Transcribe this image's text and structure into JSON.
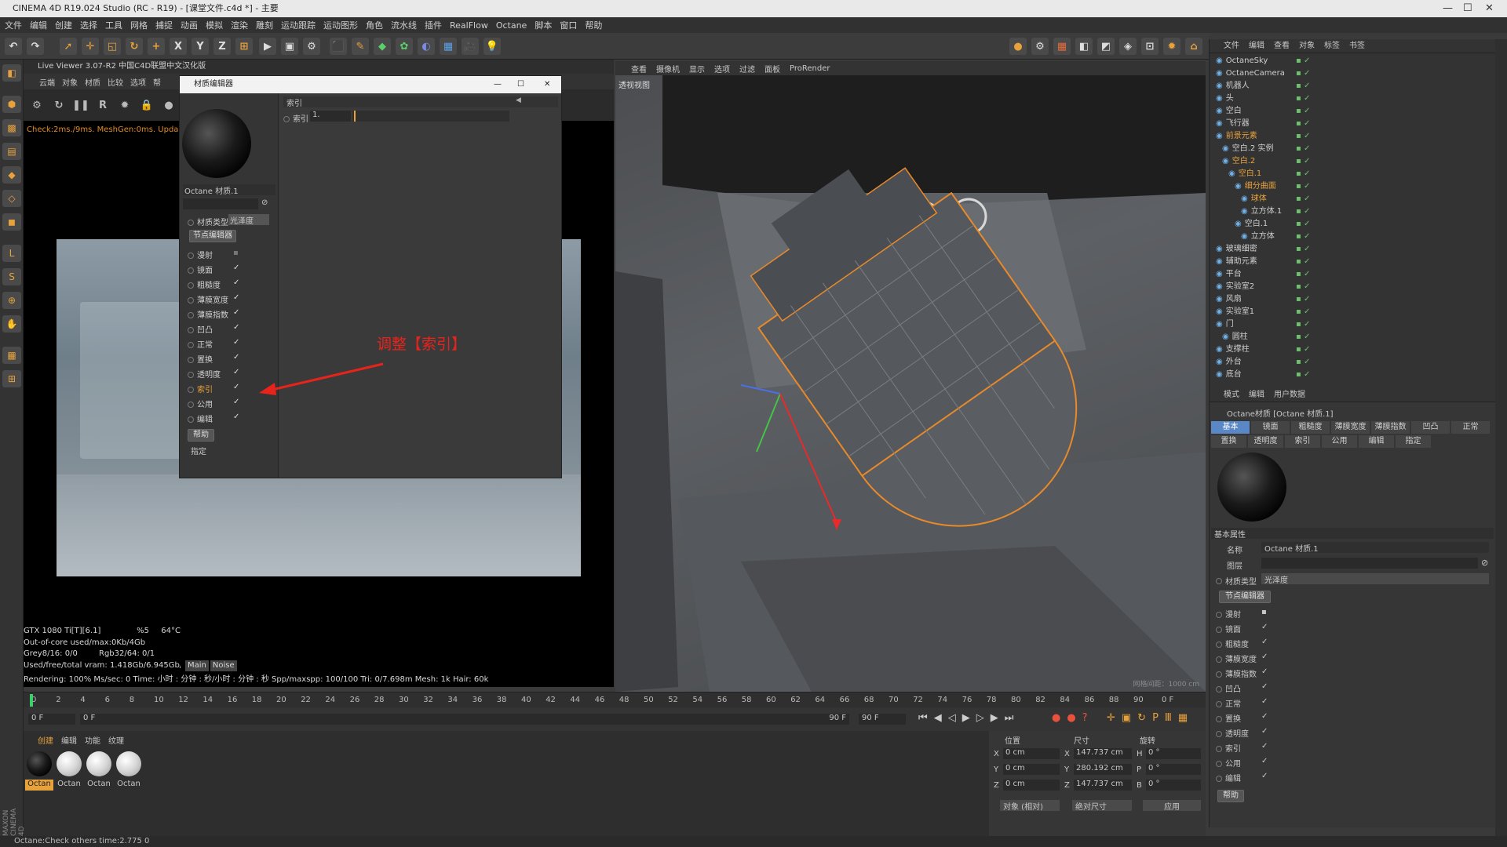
{
  "window": {
    "title": "CINEMA 4D R19.024 Studio (RC - R19) - [课堂文件.c4d *] - 主要"
  },
  "menu": [
    "文件",
    "编辑",
    "创建",
    "选择",
    "工具",
    "网格",
    "捕捉",
    "动画",
    "模拟",
    "渲染",
    "雕刻",
    "运动跟踪",
    "运动图形",
    "角色",
    "流水线",
    "插件",
    "RealFlow",
    "Octane",
    "脚本",
    "窗口",
    "帮助"
  ],
  "toolbar": {
    "x": "X",
    "y": "Y",
    "z": "Z"
  },
  "live_viewer": {
    "title": "Live Viewer 3.07-R2 中国C4D联盟中文汉化版",
    "menu": [
      "云端",
      "对象",
      "材质",
      "比较",
      "选项",
      "帮"
    ],
    "status_text": "Check:2ms./9ms. MeshGen:0ms. Upda",
    "stats": {
      "gpu": "GTX 1080 Ti[T][6.1]",
      "gpu_pct": "%5",
      "gpu_temp": "64°C",
      "out_of_core": "Out-of-core used/max:0Kb/4Gb",
      "grey": "Grey8/16: 0/0",
      "rgb": "Rgb32/64: 0/1",
      "vram": "Used/free/total vram: 1.418Gb/6.945Gb/11",
      "tab_main": "Main",
      "tab_noise": "Noise",
      "rendering": "Rendering: 100%   Ms/sec: 0   Time: 小时 : 分钟 : 秒/小时 : 分钟 : 秒   Spp/maxspp: 100/100   Tri: 0/7.698m   Mesh: 1k   Hair: 60k"
    }
  },
  "material_editor": {
    "title": "材质编辑器",
    "material_name": "Octane 材质.1",
    "material_type_label": "材质类型",
    "material_type_value": "光泽度",
    "node_editor": "节点编辑器",
    "channels": [
      "漫射",
      "镜面",
      "粗糙度",
      "薄膜宽度",
      "薄膜指数",
      "凹凸",
      "正常",
      "置换",
      "透明度",
      "索引",
      "公用",
      "编辑"
    ],
    "help": "帮助",
    "assign": "指定",
    "section_title": "索引",
    "index_label": "索引",
    "index_value": "1."
  },
  "annotation": {
    "text": "调整【索引】",
    "color": "#e8231c"
  },
  "viewport": {
    "menu": [
      "查看",
      "摄像机",
      "显示",
      "选项",
      "过滤",
      "面板",
      "ProRender"
    ],
    "label": "透视视图",
    "watermark": "网格间距：1000 cm"
  },
  "timeline": {
    "ticks": [
      "0",
      "2",
      "4",
      "6",
      "8",
      "10",
      "12",
      "14",
      "16",
      "18",
      "20",
      "22",
      "24",
      "26",
      "28",
      "30",
      "32",
      "34",
      "36",
      "38",
      "40",
      "42",
      "44",
      "46",
      "48",
      "50",
      "52",
      "54",
      "56",
      "58",
      "60",
      "62",
      "64",
      "66",
      "68",
      "70",
      "72",
      "74",
      "76",
      "78",
      "80",
      "82",
      "84",
      "86",
      "88",
      "90"
    ],
    "end": "0 F",
    "start_field": "0 F",
    "min_field": "0 F",
    "max_field": "90 F",
    "max_field2": "90 F"
  },
  "material_manager": {
    "menu": [
      "创建",
      "编辑",
      "功能",
      "纹理"
    ],
    "materials": [
      "Octan",
      "Octan",
      "Octan",
      "Octan"
    ]
  },
  "coordinates": {
    "headers": [
      "位置",
      "尺寸",
      "旋转"
    ],
    "rows": [
      {
        "axis": "X",
        "pos": "0 cm",
        "size_axis": "X",
        "size": "147.737 cm",
        "rot_axis": "H",
        "rot": "0 °"
      },
      {
        "axis": "Y",
        "pos": "0 cm",
        "size_axis": "Y",
        "size": "280.192 cm",
        "rot_axis": "P",
        "rot": "0 °"
      },
      {
        "axis": "Z",
        "pos": "0 cm",
        "size_axis": "Z",
        "size": "147.737 cm",
        "rot_axis": "B",
        "rot": "0 °"
      }
    ],
    "mode": "对象 (相对)",
    "size_mode": "绝对尺寸",
    "apply": "应用"
  },
  "object_manager": {
    "menu": [
      "文件",
      "编辑",
      "查看",
      "对象",
      "标签",
      "书签"
    ],
    "objects": [
      {
        "name": "OctaneSky",
        "indent": 0,
        "color": "#cfcfcf"
      },
      {
        "name": "OctaneCamera",
        "indent": 0,
        "color": "#cfcfcf"
      },
      {
        "name": "机器人",
        "indent": 0,
        "color": "#cfcfcf"
      },
      {
        "name": "头",
        "indent": 0,
        "color": "#cfcfcf"
      },
      {
        "name": "空白",
        "indent": 0,
        "color": "#cfcfcf"
      },
      {
        "name": "飞行器",
        "indent": 0,
        "color": "#cfcfcf"
      },
      {
        "name": "前景元素",
        "indent": 0,
        "color": "#e8a23c"
      },
      {
        "name": "空白.2 实例",
        "indent": 1,
        "color": "#cfcfcf"
      },
      {
        "name": "空白.2",
        "indent": 1,
        "color": "#e8a23c"
      },
      {
        "name": "空白.1",
        "indent": 2,
        "color": "#e8a23c"
      },
      {
        "name": "细分曲面",
        "indent": 3,
        "color": "#e8a23c"
      },
      {
        "name": "球体",
        "indent": 4,
        "color": "#e8a23c"
      },
      {
        "name": "立方体.1",
        "indent": 4,
        "color": "#cfcfcf"
      },
      {
        "name": "空白.1",
        "indent": 3,
        "color": "#cfcfcf"
      },
      {
        "name": "立方体",
        "indent": 4,
        "color": "#cfcfcf"
      },
      {
        "name": "玻璃细密",
        "indent": 0,
        "color": "#cfcfcf"
      },
      {
        "name": "辅助元素",
        "indent": 0,
        "color": "#cfcfcf"
      },
      {
        "name": "平台",
        "indent": 0,
        "color": "#cfcfcf"
      },
      {
        "name": "实验室2",
        "indent": 0,
        "color": "#cfcfcf"
      },
      {
        "name": "风扇",
        "indent": 0,
        "color": "#cfcfcf"
      },
      {
        "name": "实验室1",
        "indent": 0,
        "color": "#cfcfcf"
      },
      {
        "name": "门",
        "indent": 0,
        "color": "#cfcfcf"
      },
      {
        "name": "圆柱",
        "indent": 1,
        "color": "#cfcfcf"
      },
      {
        "name": "支撑柱",
        "indent": 0,
        "color": "#cfcfcf"
      },
      {
        "name": "外台",
        "indent": 0,
        "color": "#cfcfcf"
      },
      {
        "name": "底台",
        "indent": 0,
        "color": "#cfcfcf"
      }
    ]
  },
  "attributes": {
    "menu": [
      "模式",
      "编辑",
      "用户数据"
    ],
    "title": "Octane材质 [Octane 材质.1]",
    "tabs_row1": [
      "基本",
      "镜面",
      "粗糙度",
      "薄膜宽度",
      "薄膜指数",
      "凹凸",
      "正常"
    ],
    "tabs_row2": [
      "置换",
      "透明度",
      "索引",
      "公用",
      "编辑",
      "指定"
    ],
    "section": "基本属性",
    "name_label": "名称",
    "name_value": "Octane 材质.1",
    "layer_label": "图层",
    "type_label": "材质类型",
    "type_value": "光泽度",
    "node_editor": "节点编辑器",
    "channels": [
      "漫射",
      "镜面",
      "粗糙度",
      "薄膜宽度",
      "薄膜指数",
      "凹凸",
      "正常",
      "置换",
      "透明度",
      "索引",
      "公用",
      "编辑"
    ],
    "help": "帮助"
  },
  "status_bar": "Octane:Check others time:2.775  0"
}
